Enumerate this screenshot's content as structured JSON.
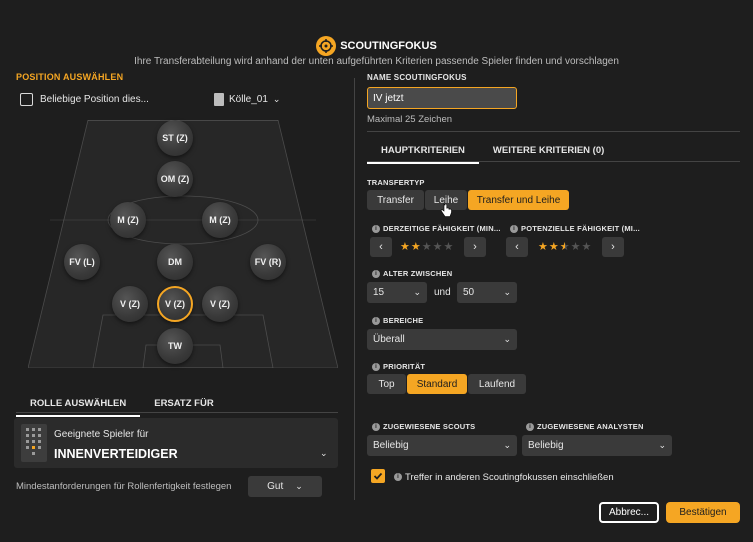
{
  "header": {
    "title": "SCOUTINGFOKUS",
    "subtitle": "Ihre Transferabteilung wird anhand der unten aufgeführten Kriterien passende Spieler finden und vorschlagen"
  },
  "left": {
    "position_heading": "POSITION AUSWÄHLEN",
    "any_position_label": "Beliebige Position dies...",
    "tactic_name": "Kölle_01",
    "positions": [
      {
        "label": "ST (Z)",
        "id": "st"
      },
      {
        "label": "OM (Z)",
        "id": "om"
      },
      {
        "label": "M (Z)",
        "id": "m-left"
      },
      {
        "label": "M (Z)",
        "id": "m-right"
      },
      {
        "label": "FV (L)",
        "id": "fv-l"
      },
      {
        "label": "DM",
        "id": "dm"
      },
      {
        "label": "FV (R)",
        "id": "fv-r"
      },
      {
        "label": "V (Z)",
        "id": "v-left"
      },
      {
        "label": "V (Z)",
        "id": "v-center"
      },
      {
        "label": "V (Z)",
        "id": "v-right"
      },
      {
        "label": "TW",
        "id": "tw"
      }
    ],
    "tabs": [
      "ROLLE AUSWÄHLEN",
      "ERSATZ FÜR"
    ],
    "role_card": {
      "caption": "Geeignete Spieler für",
      "role": "INNENVERTEIDIGER"
    },
    "min_req_label": "Mindestanforderungen für Rollenfertigkeit festlegen",
    "min_req_value": "Gut"
  },
  "right": {
    "name_label": "NAME SCOUTINGFOKUS",
    "name_value": "IV jetzt",
    "name_hint": "Maximal 25 Zeichen",
    "tabs": [
      "HAUPTKRITERIEN",
      "WEITERE KRITERIEN (0)"
    ],
    "transfer_type_label": "TRANSFERTYP",
    "transfer_types": [
      "Transfer",
      "Leihe",
      "Transfer und Leihe"
    ],
    "current_ability_label": "DERZEITIGE FÄHIGKEIT (MIN...",
    "potential_ability_label": "POTENZIELLE FÄHIGKEIT (MI...",
    "current_ability_stars": 2,
    "potential_ability_stars": 2.5,
    "age_label": "ALTER ZWISCHEN",
    "age_min": "15",
    "age_and": "und",
    "age_max": "50",
    "areas_label": "BEREICHE",
    "areas_value": "Überall",
    "priority_label": "PRIORITÄT",
    "priorities": [
      "Top",
      "Standard",
      "Laufend"
    ],
    "scouts_label": "ZUGEWIESENE SCOUTS",
    "scouts_value": "Beliebig",
    "analysts_label": "ZUGEWIESENE ANALYSTEN",
    "analysts_value": "Beliebig",
    "include_label": "Treffer in anderen Scoutingfokussen einschließen"
  },
  "footer": {
    "cancel": "Abbrec...",
    "confirm": "Bestätigen"
  },
  "colors": {
    "accent": "#f5a623",
    "background": "#1e1e1e"
  }
}
